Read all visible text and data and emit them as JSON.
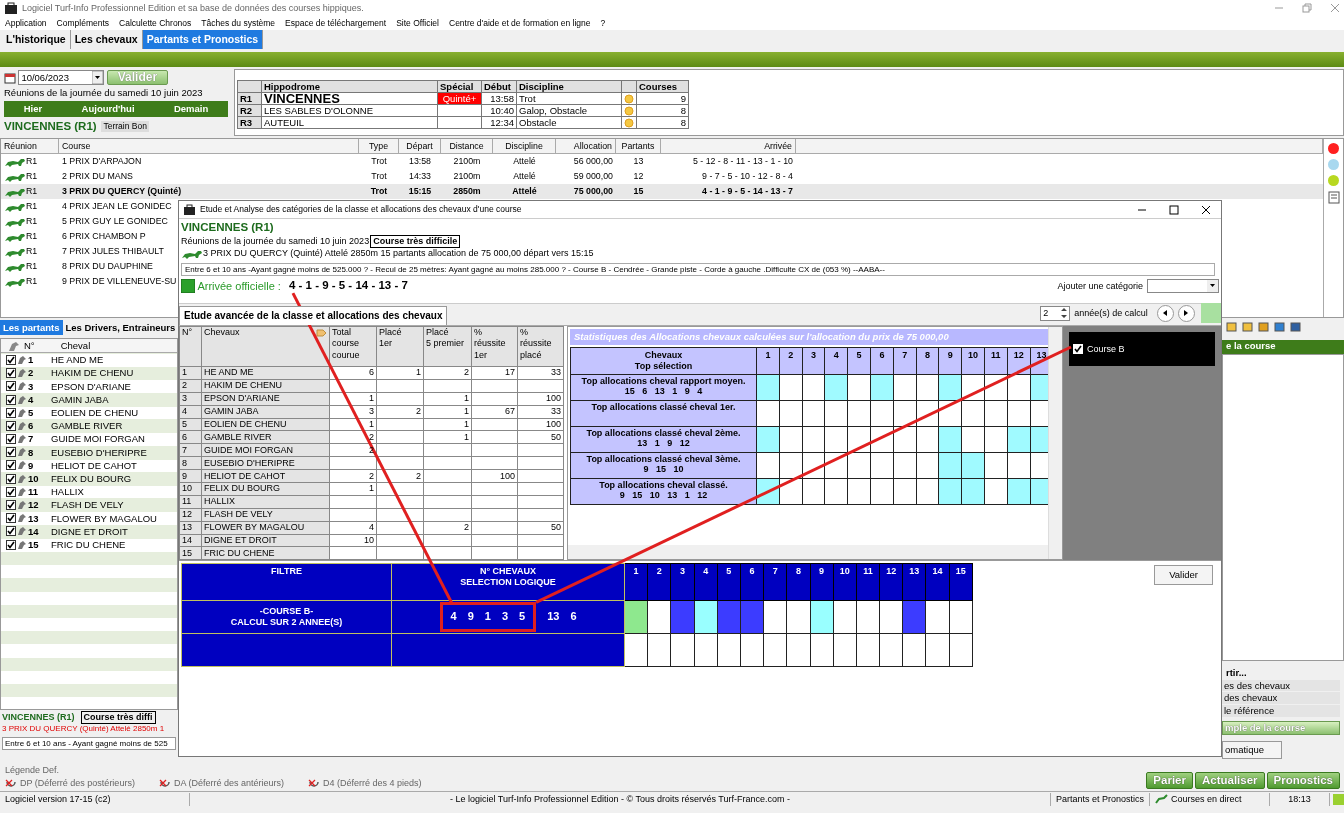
{
  "window": {
    "title": "Logiciel Turf-Info Professionnel Edition et sa base de données des courses hippiques."
  },
  "menu": [
    "Application",
    "Compléments",
    "Calculette Chronos",
    "Tâches du système",
    "Espace de téléchargement",
    "Site Officiel",
    "Centre d'aide et de formation en ligne",
    "?"
  ],
  "tabs": [
    {
      "label": "L'historique",
      "selected": false
    },
    {
      "label": "Les chevaux",
      "selected": false
    },
    {
      "label": "Partants et Pronostics",
      "selected": true
    }
  ],
  "date_panel": {
    "date": "10/06/2023",
    "validate": "Valider",
    "day_label": "Réunions de la journée du samedi 10 juin 2023",
    "nav": [
      "Hier",
      "Aujourd'hui",
      "Demain"
    ],
    "meeting": "VINCENNES (R1)",
    "terrain": "Terrain Bon"
  },
  "meetings": {
    "columns": [
      "Hippodrome",
      "Spécial",
      "Début",
      "Discipline",
      "Courses"
    ],
    "rows": [
      {
        "code": "R1",
        "hippodrome": "VINCENNES",
        "special": "Quinté+",
        "start": "13:58",
        "discipline": "Trot",
        "courses": "9",
        "selected": true
      },
      {
        "code": "R2",
        "hippodrome": "LES SABLES D'OLONNE",
        "start": "10:40",
        "discipline": "Galop, Obstacle",
        "courses": "8",
        "selected": false
      },
      {
        "code": "R3",
        "hippodrome": "AUTEUIL",
        "start": "12:34",
        "discipline": "Obstacle",
        "courses": "8",
        "selected": false
      }
    ]
  },
  "races": {
    "columns": [
      "Réunion",
      "Course",
      "Type",
      "Départ",
      "Distance",
      "Discipline",
      "Allocation",
      "Partants",
      "Arrivée"
    ],
    "rows": [
      {
        "reunion": "R1",
        "course": "1 PRIX D'ARPAJON",
        "type": "Trot",
        "depart": "13:58",
        "distance": "2100m",
        "discipline": "Attelé",
        "allocation": "56 000,00",
        "partants": "13",
        "arrivee": "5 - 12 - 8 - 11 - 13 - 1 - 10",
        "selected": false
      },
      {
        "reunion": "R1",
        "course": "2 PRIX DU MANS",
        "type": "Trot",
        "depart": "14:33",
        "distance": "2100m",
        "discipline": "Attelé",
        "allocation": "59 000,00",
        "partants": "12",
        "arrivee": "9 - 7 - 5 - 10 - 12 - 8 - 4",
        "selected": false
      },
      {
        "reunion": "R1",
        "course": "3 PRIX DU QUERCY (Quinté)",
        "type": "Trot",
        "depart": "15:15",
        "distance": "2850m",
        "discipline": "Attelé",
        "allocation": "75 000,00",
        "partants": "15",
        "arrivee": "4 - 1 - 9 - 5 - 14 - 13 - 7",
        "selected": true
      },
      {
        "reunion": "R1",
        "course": "4 PRIX JEAN LE GONIDEC",
        "selected": false
      },
      {
        "reunion": "R1",
        "course": "5 PRIX GUY LE GONIDEC",
        "selected": false
      },
      {
        "reunion": "R1",
        "course": "6 PRIX CHAMBON P",
        "selected": false
      },
      {
        "reunion": "R1",
        "course": "7 PRIX JULES THIBAULT",
        "selected": false
      },
      {
        "reunion": "R1",
        "course": "8 PRIX DU DAUPHINE",
        "selected": false
      },
      {
        "reunion": "R1",
        "course": "9 PRIX DE VILLENEUVE-SU",
        "selected": false
      }
    ]
  },
  "status_dots": [
    {
      "color": "#ff2020"
    },
    {
      "color": "#a8d8ef"
    },
    {
      "color": "#b8d820"
    }
  ],
  "runners": {
    "tabs": [
      {
        "label": "Les partants",
        "selected": true
      },
      {
        "label": "Les Drivers, Entraineurs",
        "selected": false
      }
    ],
    "columns": [
      "N°",
      "Cheval"
    ],
    "rows": [
      {
        "n": "1",
        "name": "HE AND ME",
        "checked": true
      },
      {
        "n": "2",
        "name": "HAKIM DE CHENU",
        "checked": true
      },
      {
        "n": "3",
        "name": "EPSON D'ARIANE",
        "checked": true
      },
      {
        "n": "4",
        "name": "GAMIN JABA",
        "checked": true
      },
      {
        "n": "5",
        "name": "EOLIEN DE CHENU",
        "checked": true
      },
      {
        "n": "6",
        "name": "GAMBLE RIVER",
        "checked": true
      },
      {
        "n": "7",
        "name": "GUIDE MOI FORGAN",
        "checked": true
      },
      {
        "n": "8",
        "name": "EUSEBIO D'HERIPRE",
        "checked": true
      },
      {
        "n": "9",
        "name": "HELIOT DE CAHOT",
        "checked": true
      },
      {
        "n": "10",
        "name": "FELIX DU BOURG",
        "checked": true
      },
      {
        "n": "11",
        "name": "HALLIX",
        "checked": true
      },
      {
        "n": "12",
        "name": "FLASH DE VELY",
        "checked": true
      },
      {
        "n": "13",
        "name": "FLOWER BY MAGALOU",
        "checked": true
      },
      {
        "n": "14",
        "name": "DIGNE ET DROIT",
        "checked": true
      },
      {
        "n": "15",
        "name": "FRIC DU CHENE",
        "checked": true
      }
    ]
  },
  "race_summary": {
    "meeting": "VINCENNES (R1)",
    "difficulty": "Course très diffi",
    "race": "3 PRIX DU QUERCY (Quinté) Attelé 2850m 1",
    "conditions": "Entre 6 et 10 ans  - Ayant gagné moins de 525"
  },
  "legend": {
    "title": "Légende Def.",
    "items": [
      "DP (Déferré des postérieurs)",
      "DA (Déferré des antérieurs)",
      "D4 (Déferré des 4 pieds)"
    ]
  },
  "side_panel": {
    "header": "e la course",
    "section": "rtir...",
    "items": [
      "es des chevaux",
      "des chevaux",
      "le référence"
    ],
    "primary_button": "mple de la course",
    "secondary_button": "omatique"
  },
  "action_buttons": [
    "Parier",
    "Actualiser",
    "Pronostics"
  ],
  "status_bar": {
    "version": "Logiciel version 17-15 (c2)",
    "copyright": "- Le logiciel Turf-Info Professionnel Edition - © Tous droits réservés Turf-France.com -",
    "view": "Partants et Pronostics",
    "live": "Courses en direct",
    "time": "18:13"
  },
  "dialog": {
    "title": "Etude et Analyse des catégories de la classe et allocations des chevaux d'une course",
    "meeting": "VINCENNES (R1)",
    "day_label": "Réunions de la journée du samedi 10 juin 2023",
    "difficulty": "Course très difficile",
    "race": "3 PRIX DU QUERCY (Quinté) Attelé 2850m 15 partants allocation de 75 000,00 départ vers 15:15",
    "conditions": "Entre 6 et 10 ans  -Ayant gagné moins de 525.000 ?  - Recul de 25 mètres: Ayant gagné au moins 285.000 ?  - Course B  - Cendrée  - Grande piste  - Corde à gauche .Difficulte CX de (053 %)  --AABA--",
    "arrival_label": "Arrivée officielle :",
    "arrival": "4 - 1 - 9 - 5 - 14 - 13 - 7",
    "add_category_label": "Ajouter une catégorie",
    "tab": {
      "label": "Etude avancée de la classe et allocations des chevaux",
      "selected": true
    },
    "years": "2",
    "years_label": "année(s) de calcul",
    "horses": {
      "columns": [
        "N°",
        "Chevaux",
        "Total\ncourse\ncourue",
        "Placé\n1er",
        "Placé\n5 premier",
        "%\nréussite\n1er",
        "%\nréussite\nplacé"
      ],
      "rows": [
        {
          "n": "1",
          "name": "HE AND ME",
          "total": "6",
          "p1": "1",
          "p5": "2",
          "r1": "17",
          "rp": "33"
        },
        {
          "n": "2",
          "name": "HAKIM DE CHENU"
        },
        {
          "n": "3",
          "name": "EPSON D'ARIANE",
          "total": "1",
          "p5": "1",
          "rp": "100"
        },
        {
          "n": "4",
          "name": "GAMIN JABA",
          "total": "3",
          "p1": "2",
          "p5": "1",
          "r1": "67",
          "rp": "33"
        },
        {
          "n": "5",
          "name": "EOLIEN DE CHENU",
          "total": "1",
          "p5": "1",
          "rp": "100"
        },
        {
          "n": "6",
          "name": "GAMBLE RIVER",
          "total": "2",
          "p5": "1",
          "rp": "50"
        },
        {
          "n": "7",
          "name": "GUIDE MOI FORGAN",
          "total": "2"
        },
        {
          "n": "8",
          "name": "EUSEBIO D'HERIPRE"
        },
        {
          "n": "9",
          "name": "HELIOT DE CAHOT",
          "total": "2",
          "p1": "2",
          "r1": "100"
        },
        {
          "n": "10",
          "name": "FELIX DU BOURG",
          "total": "1"
        },
        {
          "n": "11",
          "name": "HALLIX"
        },
        {
          "n": "12",
          "name": "FLASH DE VELY"
        },
        {
          "n": "13",
          "name": "FLOWER BY MAGALOU",
          "total": "4",
          "p5": "2",
          "rp": "50"
        },
        {
          "n": "14",
          "name": "DIGNE ET DROIT",
          "total": "10"
        },
        {
          "n": "15",
          "name": "FRIC DU CHENE"
        }
      ]
    },
    "stats": {
      "title": "Statistiques des Allocations chevaux calculées sur l'allocation du prix de 75 000,00",
      "header": "Chevaux\nTop sélection",
      "columns": [
        "1",
        "2",
        "3",
        "4",
        "5",
        "6",
        "7",
        "8",
        "9",
        "10",
        "11",
        "12",
        "13"
      ],
      "rows": [
        {
          "label": "Top allocations cheval rapport moyen.",
          "picks": "15   6   13   1   9   4",
          "highlighted": [
            true,
            false,
            false,
            true,
            false,
            true,
            false,
            false,
            true,
            false,
            false,
            false,
            true
          ]
        },
        {
          "label": "Top allocations classé cheval 1er.",
          "highlighted": [
            false,
            false,
            false,
            false,
            false,
            false,
            false,
            false,
            false,
            false,
            false,
            false,
            false
          ]
        },
        {
          "label": "Top allocations classé cheval 2ème.",
          "picks": "13   1   9   12",
          "highlighted": [
            true,
            false,
            false,
            false,
            false,
            false,
            false,
            false,
            true,
            false,
            false,
            true,
            true
          ]
        },
        {
          "label": "Top allocations classé cheval 3ème.",
          "picks": "9   15   10",
          "highlighted": [
            false,
            false,
            false,
            false,
            false,
            false,
            false,
            false,
            true,
            true,
            false,
            false,
            false
          ]
        },
        {
          "label": "Top allocations cheval classé.",
          "picks": "9   15   10   13   1   12",
          "highlighted": [
            true,
            false,
            false,
            false,
            false,
            false,
            false,
            false,
            true,
            true,
            false,
            true,
            true
          ]
        }
      ]
    },
    "categories": [
      {
        "label": "Course B",
        "checked": true
      }
    ],
    "filter": {
      "columns": [
        "FILTRE",
        "N° CHEVAUX\nSELECTION LOGIQUE"
      ],
      "numbers": [
        "1",
        "2",
        "3",
        "4",
        "5",
        "6",
        "7",
        "8",
        "9",
        "10",
        "11",
        "12",
        "13",
        "14",
        "15"
      ],
      "row": {
        "filter": "-COURSE B-\nCALCUL SUR 2 ANNEE(S)",
        "framed_selection": [
          "4",
          "9",
          "1",
          "3",
          "5"
        ],
        "other_selection": [
          "13",
          "6"
        ],
        "cells": [
          {
            "color": "#8ee88e"
          },
          {
            "color": "#ffffff"
          },
          {
            "color": "#3c3cff"
          },
          {
            "color": "#99ffff"
          },
          {
            "color": "#3c3cff"
          },
          {
            "color": "#3c3cff"
          },
          {
            "color": "#ffffff"
          },
          {
            "color": "#ffffff"
          },
          {
            "color": "#99ffff"
          },
          {
            "color": "#ffffff"
          },
          {
            "color": "#ffffff"
          },
          {
            "color": "#ffffff"
          },
          {
            "color": "#3c3cff"
          },
          {
            "color": "#ffffff"
          },
          {
            "color": "#ffffff"
          }
        ]
      },
      "validate": "Valider"
    }
  }
}
